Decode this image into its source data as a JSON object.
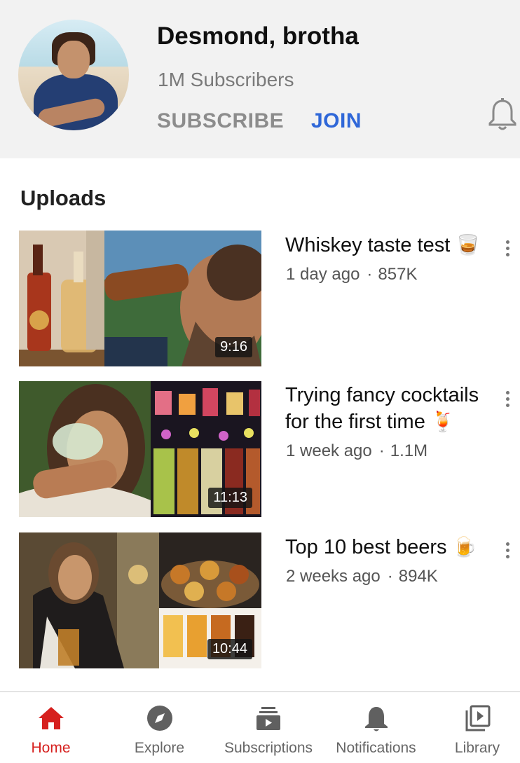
{
  "channel": {
    "name": "Desmond, brotha",
    "subscribers": "1M Subscribers",
    "subscribe_label": "SUBSCRIBE",
    "join_label": "JOIN",
    "bell_icon": "bell-outline-icon"
  },
  "uploads": {
    "title": "Uploads",
    "videos": [
      {
        "title": "Whiskey taste test",
        "emoji": "🥃",
        "age": "1 day ago",
        "views": "857K",
        "duration": "9:16"
      },
      {
        "title": "Trying fancy cocktails for the first time",
        "emoji": "🍹",
        "age": "1 week ago",
        "views": "1.1M",
        "duration": "11:13"
      },
      {
        "title": "Top 10 best beers",
        "emoji": "🍺",
        "age": "2 weeks ago",
        "views": "894K",
        "duration": "10:44"
      }
    ]
  },
  "nav": {
    "items": [
      {
        "label": "Home",
        "icon": "home-icon",
        "active": true
      },
      {
        "label": "Explore",
        "icon": "compass-icon",
        "active": false
      },
      {
        "label": "Subscriptions",
        "icon": "subscriptions-icon",
        "active": false
      },
      {
        "label": "Notifications",
        "icon": "bell-icon",
        "active": false
      },
      {
        "label": "Library",
        "icon": "library-icon",
        "active": false
      }
    ]
  },
  "colors": {
    "accent_red": "#d6201e",
    "join_blue": "#2f67d8",
    "header_bg": "#f2f2f2"
  }
}
